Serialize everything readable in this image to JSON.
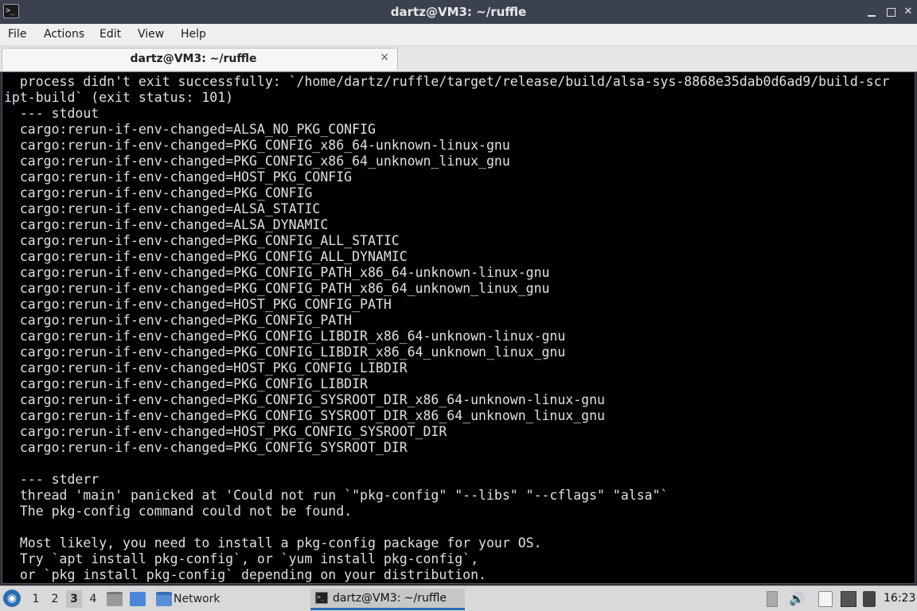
{
  "window": {
    "title": "dartz@VM3: ~/ruffle",
    "icon": "terminal-icon",
    "controls": [
      "minimize-icon",
      "maximize-icon",
      "close-icon"
    ]
  },
  "menu": {
    "items": [
      "File",
      "Actions",
      "Edit",
      "View",
      "Help"
    ]
  },
  "tab": {
    "label": "dartz@VM3: ~/ruffle",
    "close": "×"
  },
  "terminal": {
    "colors": {
      "background": "#000000",
      "foreground": "#e0e0e0"
    },
    "lines": [
      "  process didn't exit successfully: `/home/dartz/ruffle/target/release/build/alsa-sys-8868e35dab0d6ad9/build-scr",
      "ipt-build` (exit status: 101)",
      "  --- stdout",
      "  cargo:rerun-if-env-changed=ALSA_NO_PKG_CONFIG",
      "  cargo:rerun-if-env-changed=PKG_CONFIG_x86_64-unknown-linux-gnu",
      "  cargo:rerun-if-env-changed=PKG_CONFIG_x86_64_unknown_linux_gnu",
      "  cargo:rerun-if-env-changed=HOST_PKG_CONFIG",
      "  cargo:rerun-if-env-changed=PKG_CONFIG",
      "  cargo:rerun-if-env-changed=ALSA_STATIC",
      "  cargo:rerun-if-env-changed=ALSA_DYNAMIC",
      "  cargo:rerun-if-env-changed=PKG_CONFIG_ALL_STATIC",
      "  cargo:rerun-if-env-changed=PKG_CONFIG_ALL_DYNAMIC",
      "  cargo:rerun-if-env-changed=PKG_CONFIG_PATH_x86_64-unknown-linux-gnu",
      "  cargo:rerun-if-env-changed=PKG_CONFIG_PATH_x86_64_unknown_linux_gnu",
      "  cargo:rerun-if-env-changed=HOST_PKG_CONFIG_PATH",
      "  cargo:rerun-if-env-changed=PKG_CONFIG_PATH",
      "  cargo:rerun-if-env-changed=PKG_CONFIG_LIBDIR_x86_64-unknown-linux-gnu",
      "  cargo:rerun-if-env-changed=PKG_CONFIG_LIBDIR_x86_64_unknown_linux_gnu",
      "  cargo:rerun-if-env-changed=HOST_PKG_CONFIG_LIBDIR",
      "  cargo:rerun-if-env-changed=PKG_CONFIG_LIBDIR",
      "  cargo:rerun-if-env-changed=PKG_CONFIG_SYSROOT_DIR_x86_64-unknown-linux-gnu",
      "  cargo:rerun-if-env-changed=PKG_CONFIG_SYSROOT_DIR_x86_64_unknown_linux_gnu",
      "  cargo:rerun-if-env-changed=HOST_PKG_CONFIG_SYSROOT_DIR",
      "  cargo:rerun-if-env-changed=PKG_CONFIG_SYSROOT_DIR",
      "",
      "  --- stderr",
      "  thread 'main' panicked at 'Could not run `\"pkg-config\" \"--libs\" \"--cflags\" \"alsa\"`",
      "  The pkg-config command could not be found.",
      "",
      "  Most likely, you need to install a pkg-config package for your OS.",
      "  Try `apt install pkg-config`, or `yum install pkg-config`,",
      "  or `pkg install pkg-config` depending on your distribution."
    ]
  },
  "taskbar": {
    "start_icon": "start-menu-icon",
    "workspaces": [
      "1",
      "2",
      "3",
      "4"
    ],
    "active_workspace": "3",
    "quicklaunch": [
      "file-manager-icon",
      "show-desktop-icon"
    ],
    "network_label": "Network",
    "active_task_label": "dartz@VM3: ~/ruffle",
    "tray_icons": [
      "tray-expand-icon",
      "volume-icon",
      "clipboard-icon",
      "network-status-icon",
      "battery-icon"
    ],
    "clock": "16:23",
    "accent": "#2a6db5"
  }
}
